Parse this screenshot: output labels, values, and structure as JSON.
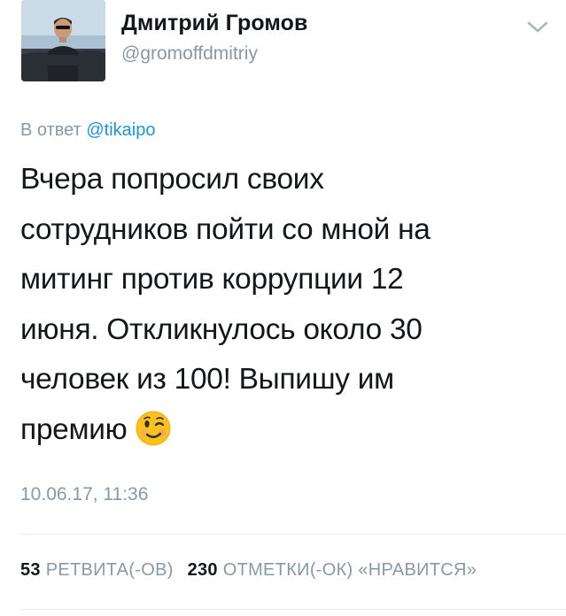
{
  "author": {
    "display_name": "Дмитрий Громов",
    "screen_name": "@gromoffdmitriy",
    "avatar_icon": "profile-photo"
  },
  "menu_icon": "chevron-down-icon",
  "reply": {
    "prefix": "В ответ",
    "mention": "@tikaipo"
  },
  "tweet": {
    "lines": [
      "Вчера попросил своих",
      "сотрудников пойти со мной на",
      "митинг против коррупции 12",
      "июня. Откликнулось около 30",
      "человек из 100! Выпишу им",
      "премию"
    ],
    "emoji": "winking-face-emoji"
  },
  "timestamp": "10.06.17, 11:36",
  "stats": {
    "retweets_count": "53",
    "retweets_label": "РЕТВИТА(-ОВ)",
    "likes_count": "230",
    "likes_label": "ОТМЕТКИ(-ОК) «НРАВИТСЯ»"
  },
  "colors": {
    "text": "#14171a",
    "secondary": "#8899a6",
    "link": "#1b95e0",
    "divider": "#e6ecf0"
  }
}
